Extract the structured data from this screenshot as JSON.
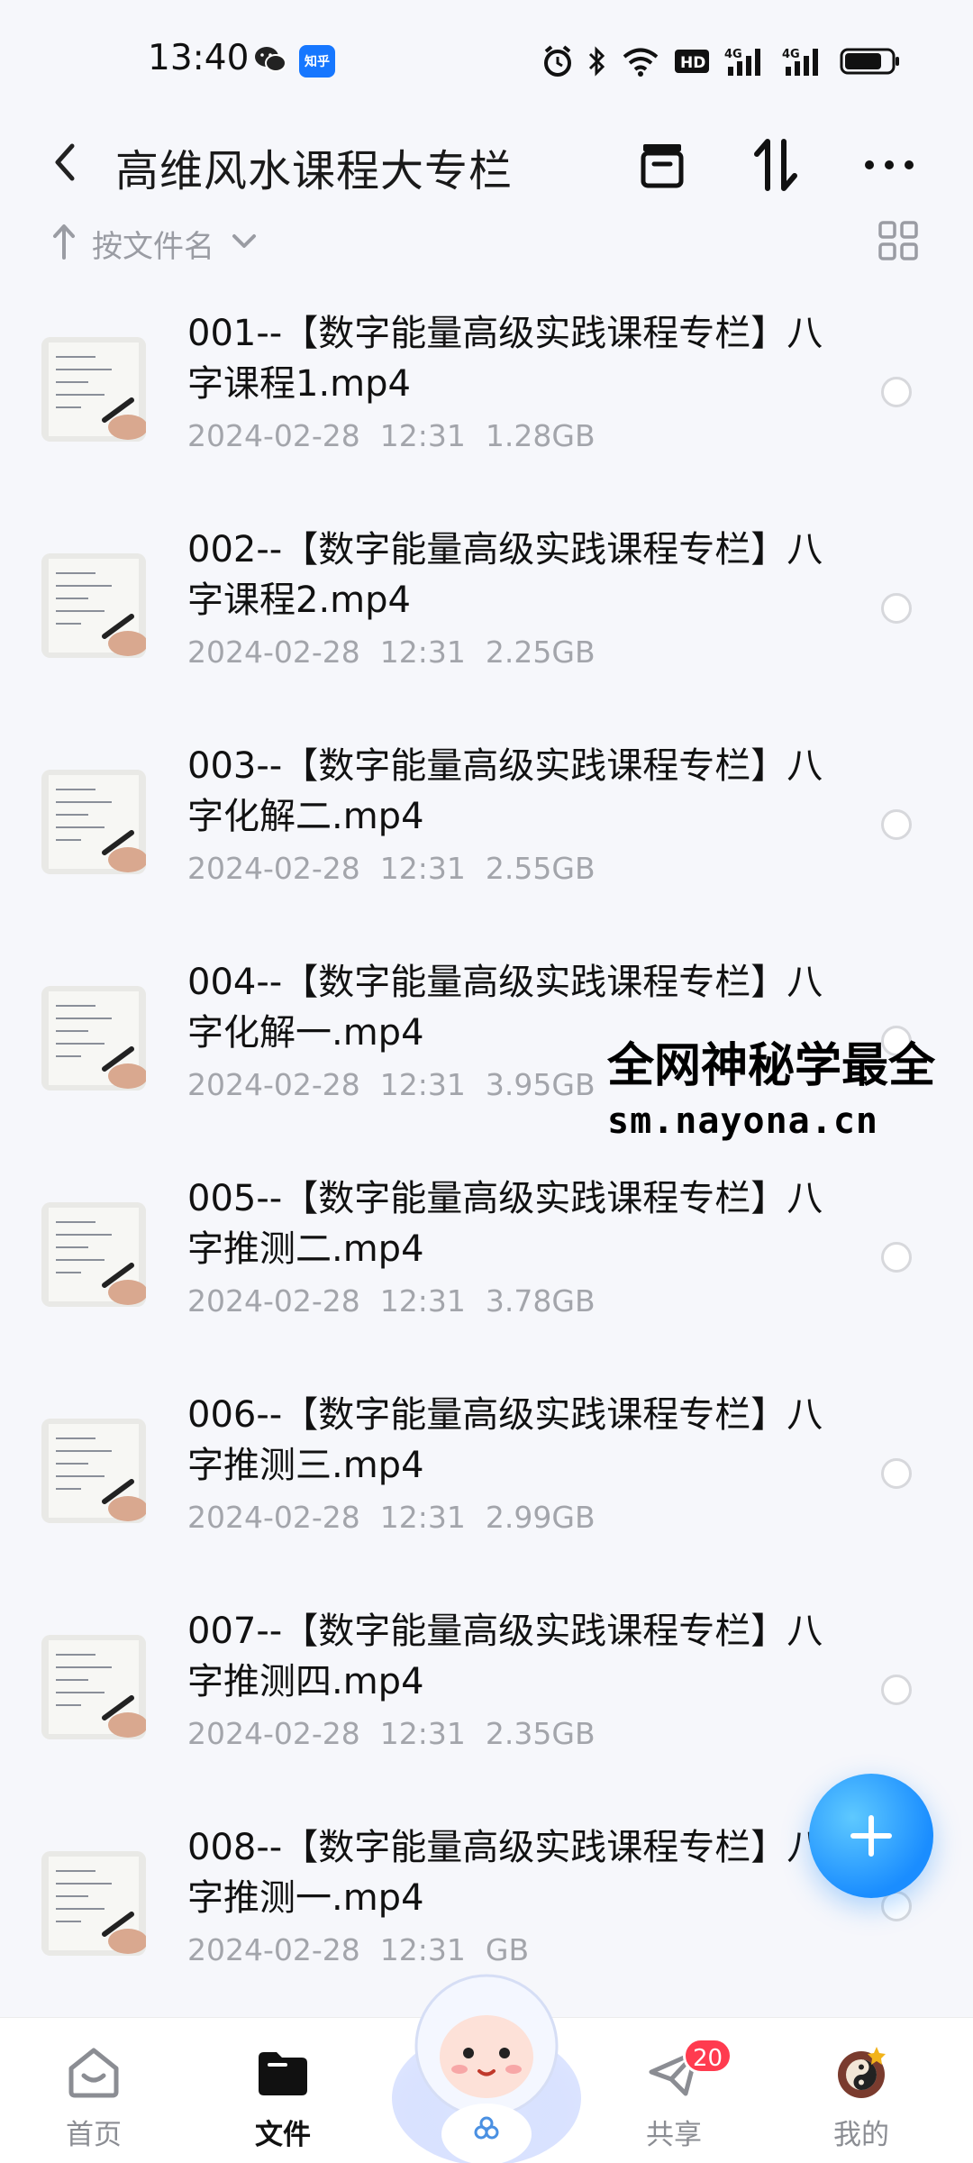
{
  "status_bar": {
    "time": "13:40",
    "zhihu_label": "知乎",
    "hd_label": "HD",
    "net1": "4G",
    "net2": "4G"
  },
  "header": {
    "title": "高维风水课程大专栏"
  },
  "sort": {
    "label": "按文件名"
  },
  "files": [
    {
      "name": "001--【数字能量高级实践课程专栏】八字课程1.mp4",
      "date": "2024-02-28",
      "time": "12:31",
      "size": "1.28GB"
    },
    {
      "name": "002--【数字能量高级实践课程专栏】八字课程2.mp4",
      "date": "2024-02-28",
      "time": "12:31",
      "size": "2.25GB"
    },
    {
      "name": "003--【数字能量高级实践课程专栏】八字化解二.mp4",
      "date": "2024-02-28",
      "time": "12:31",
      "size": "2.55GB"
    },
    {
      "name": "004--【数字能量高级实践课程专栏】八字化解一.mp4",
      "date": "2024-02-28",
      "time": "12:31",
      "size": "3.95GB"
    },
    {
      "name": "005--【数字能量高级实践课程专栏】八字推测二.mp4",
      "date": "2024-02-28",
      "time": "12:31",
      "size": "3.78GB"
    },
    {
      "name": "006--【数字能量高级实践课程专栏】八字推测三.mp4",
      "date": "2024-02-28",
      "time": "12:31",
      "size": "2.99GB"
    },
    {
      "name": "007--【数字能量高级实践课程专栏】八字推测四.mp4",
      "date": "2024-02-28",
      "time": "12:31",
      "size": "2.35GB"
    },
    {
      "name": "008--【数字能量高级实践课程专栏】八字推测一.mp4",
      "date": "2024-02-28",
      "time": "12:31",
      "size": "GB"
    }
  ],
  "watermark": {
    "line1": "全网神秘学最全",
    "line2": "sm.nayona.cn"
  },
  "nav": {
    "home": "首页",
    "files": "文件",
    "share": "共享",
    "mine": "我的",
    "share_badge": "20"
  },
  "colors": {
    "accent": "#1a8dff",
    "badge": "#ff3b4f",
    "meta_text": "#a3a5ab"
  }
}
